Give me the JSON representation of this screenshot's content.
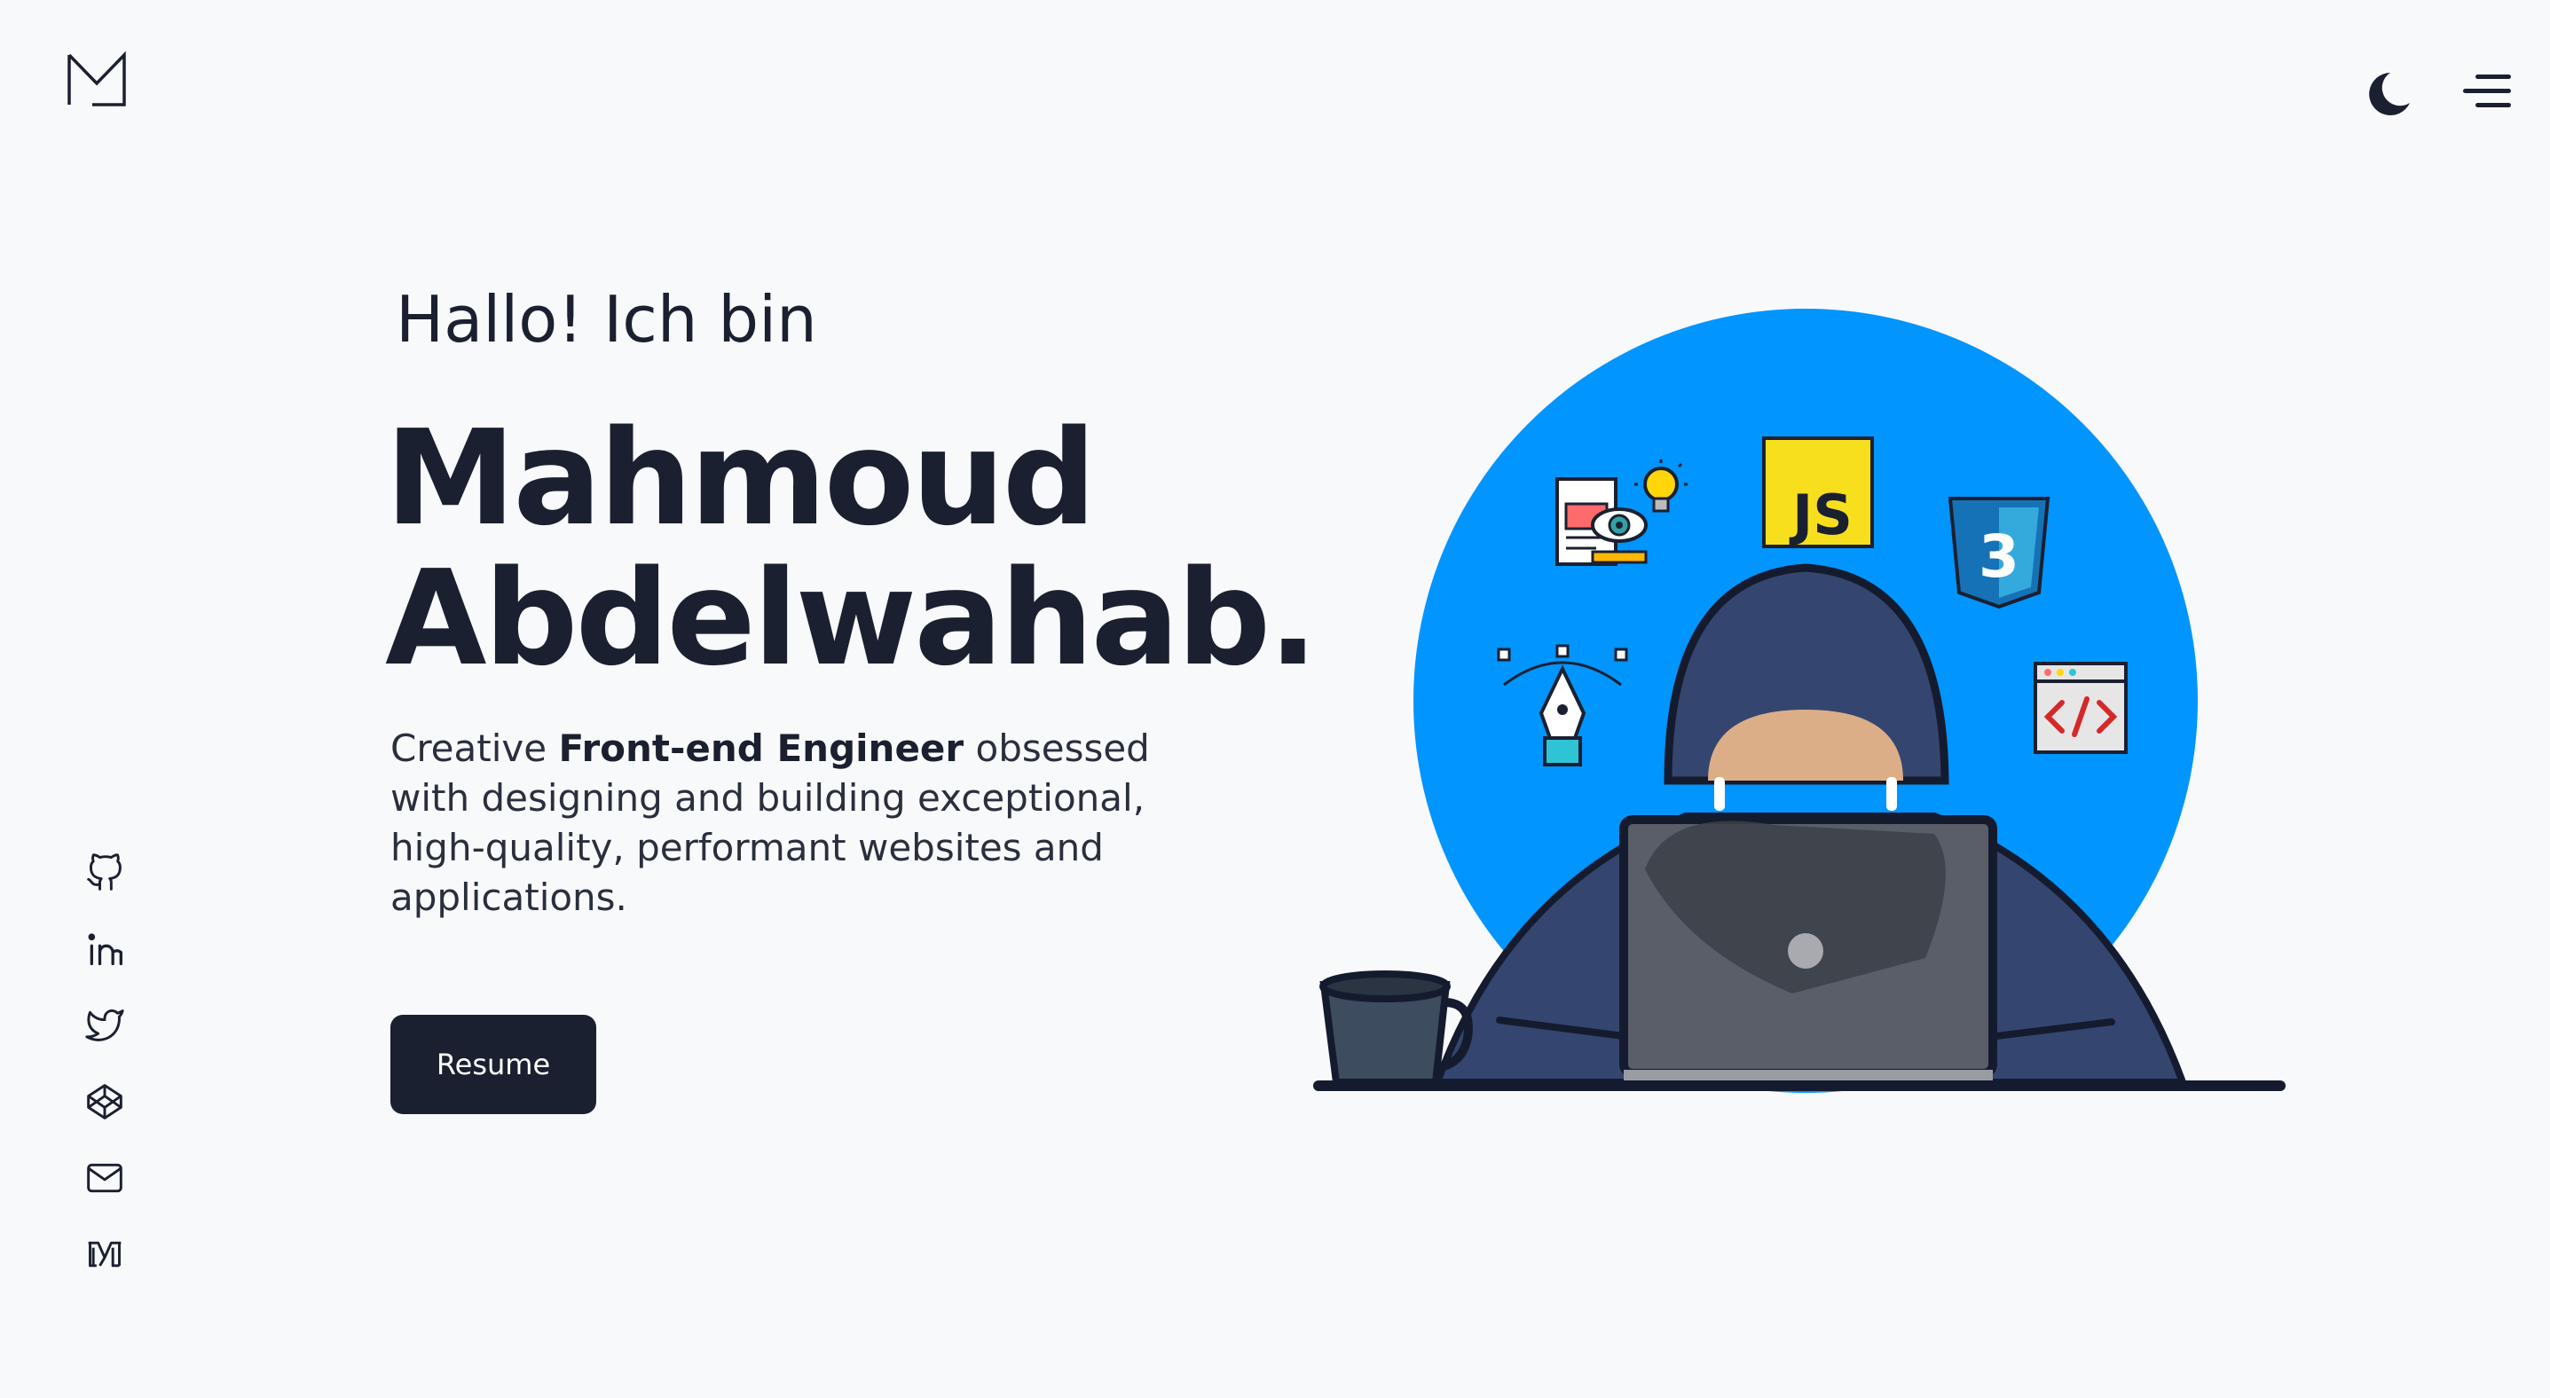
{
  "header": {
    "logo_icon": "m-monogram-logo",
    "theme_toggle_icon": "moon-icon",
    "menu_icon": "hamburger-menu-icon"
  },
  "hero": {
    "greeting": "Hallo! Ich bin",
    "name_line1": "Mahmoud",
    "name_line2": "Abdelwahab.",
    "bio_before": "Creative ",
    "bio_highlight": "Front-end Engineer",
    "bio_after": " obsessed with designing and building exceptional, high-quality, performant websites and applications.",
    "resume_label": "Resume"
  },
  "social": [
    {
      "icon": "github-icon"
    },
    {
      "icon": "linkedin-icon"
    },
    {
      "icon": "twitter-icon"
    },
    {
      "icon": "codepen-icon"
    },
    {
      "icon": "mail-icon"
    },
    {
      "icon": "medium-icon"
    }
  ],
  "illustration": {
    "badge_js": "JS",
    "badge_css": "3"
  },
  "colors": {
    "background": "#f8f9fb",
    "text": "#1b2030",
    "button": "#1b2030",
    "accent_blue": "#0095ff",
    "hoodie": "#34466f"
  }
}
